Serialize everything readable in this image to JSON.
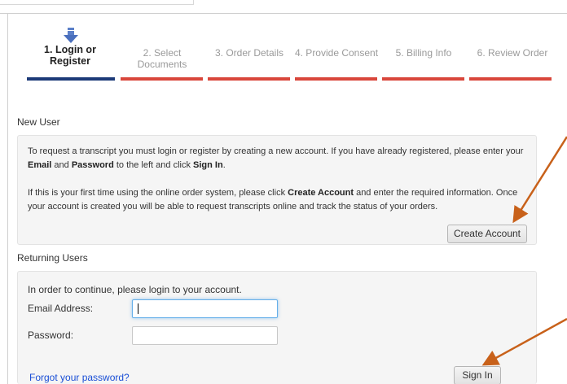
{
  "steps": [
    {
      "label_line1": "1. Login or",
      "label_line2": "Register",
      "active": true
    },
    {
      "label_line1": "2. Select",
      "label_line2": "Documents",
      "active": false
    },
    {
      "label_line1": "3. Order Details",
      "label_line2": "",
      "active": false
    },
    {
      "label_line1": "4. Provide Consent",
      "label_line2": "",
      "active": false
    },
    {
      "label_line1": "5. Billing Info",
      "label_line2": "",
      "active": false
    },
    {
      "label_line1": "6. Review Order",
      "label_line2": "",
      "active": false
    }
  ],
  "new_user": {
    "title": "New User",
    "para1_a": "To request a transcript you must login or register by creating a new account. If you have already registered, please enter your ",
    "para1_email": "Email",
    "para1_b": " and ",
    "para1_password": "Password",
    "para1_c": " to the left and click ",
    "para1_signin": "Sign In",
    "para1_d": ".",
    "para2_a": "If this is your first time using the online order system, please click ",
    "para2_create": "Create Account",
    "para2_b": " and enter the required information. Once your account is created you will be able to request transcripts online and track the status of your orders.",
    "create_button": "Create Account"
  },
  "returning": {
    "title": "Returning Users",
    "intro": "In order to continue, please login to your account.",
    "email_label": "Email Address:",
    "password_label": "Password:",
    "email_value": "",
    "password_value": "",
    "forgot_link": "Forgot your password?",
    "signin_button": "Sign In"
  },
  "colors": {
    "active_step_bar": "#1c3a78",
    "inactive_step_bar": "#d9463b",
    "annotation_arrow": "#c8611a",
    "link": "#1a4fd6"
  },
  "icons": {
    "current_step": "down-arrow-icon"
  }
}
